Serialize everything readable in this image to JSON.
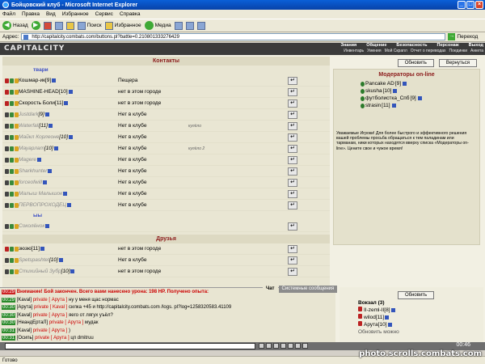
{
  "window": {
    "title": "Бойцовский клуб - Microsoft Internet Explorer"
  },
  "menu": [
    "Файл",
    "Правка",
    "Вид",
    "Избранное",
    "Сервис",
    "Справка"
  ],
  "toolbar": {
    "back": "Назад",
    "search": "Поиск",
    "favorites": "Избранное",
    "media": "Медиа"
  },
  "address": {
    "label": "Адрес:",
    "url": "http://capitalcity.combats.com/buttons.pl?battle=0.210801333276429",
    "go": "Переход"
  },
  "game": {
    "logo": "CAPITALCITY",
    "nav_top": [
      "Знания",
      "Общение",
      "Безопасность",
      "Персонаж",
      "Выход"
    ],
    "nav_bottom": [
      "Инвентарь",
      "Умения",
      "Мой Скрапл",
      "Отчет о переводах",
      "Поединки",
      "Анкета"
    ]
  },
  "contacts": {
    "title": "Контакты",
    "group1": "твари",
    "group2": "ыы",
    "friends_title": "Друзья",
    "rows": [
      {
        "name": "Кошмар-ик",
        "level": "[9]",
        "loc": "Пещера",
        "note": "",
        "online": true
      },
      {
        "name": "MASHINE-HEAD",
        "level": "[10]",
        "loc": "нет в этом городе",
        "note": "",
        "online": true
      },
      {
        "name": "Скорость Боли",
        "level": "[11]",
        "loc": "нет в этом городе",
        "note": "",
        "online": true
      },
      {
        "name": "Justdark",
        "level": "[9]",
        "loc": "Нет в клубе",
        "note": "",
        "online": false
      },
      {
        "name": "Waterfall",
        "level": "[11]",
        "loc": "Нет в клубе",
        "note": "кулёло",
        "online": false
      },
      {
        "name": "Майкл Корлеоне",
        "level": "[10]",
        "loc": "Нет в клубе",
        "note": "",
        "online": false
      },
      {
        "name": "Мауарлат",
        "level": "[10]",
        "loc": "Нет в клубе",
        "note": "кулёло 2",
        "online": false
      },
      {
        "name": "Magere",
        "level": "",
        "loc": "Нет в клубе",
        "note": "",
        "online": false
      },
      {
        "name": "Sharkhunter",
        "level": "",
        "loc": "Нет в клубе",
        "note": "",
        "online": false
      },
      {
        "name": "forceofwill",
        "level": "",
        "loc": "Нет в клубе",
        "note": "",
        "online": false
      },
      {
        "name": "Малыш Малышок",
        "level": "",
        "loc": "Нет в клубе",
        "note": "",
        "online": false
      },
      {
        "name": "ПЕРВОПРОХОДЕЦ",
        "level": "",
        "loc": "Нет в клубе",
        "note": "",
        "online": false
      }
    ],
    "group2_rows": [
      {
        "name": "Соколёнок",
        "level": "",
        "loc": "",
        "note": "",
        "online": false
      }
    ],
    "friends_rows": [
      {
        "name": "зюзю",
        "level": "[11]",
        "loc": "нет в этом городе",
        "online": true
      },
      {
        "name": "Spetspashtet",
        "level": "[10]",
        "loc": "Нет в клубе",
        "online": false
      },
      {
        "name": "Стихийный Зубр",
        "level": "[10]",
        "loc": "нет в этом городе",
        "online": false
      }
    ]
  },
  "right": {
    "refresh": "Обновить",
    "return": "Вернуться",
    "mods_title": "Модераторы on-line",
    "mods": [
      {
        "name": "Pancake AD",
        "level": "[9]"
      },
      {
        "name": "skusha",
        "level": "[10]"
      },
      {
        "name": "футболистка_Спб",
        "level": "[9]"
      },
      {
        "name": "strasin",
        "level": "[11]"
      }
    ],
    "mods_msg": "Уважаемые Игроки! Для более быстрого и эффективного решения вашей проблемы просьба обращаться к тем паладинам или тарманам, ники которых находятся вверху списка «Модераторы on-line». Цените свое и чужое время!"
  },
  "chat": {
    "tab_chat": "Чат",
    "tab_system": "Системные сообщения",
    "lines": [
      {
        "time": "00:29",
        "from": "",
        "to": "",
        "text": "Внимание! Бой закончен. Всего вами нанесено урона: 198 HP. Получено опыта:",
        "sys": true
      },
      {
        "time": "00:29",
        "from": "[Kaval]",
        "to": "private [ Арута ]",
        "text": "ну у меня щас нормас",
        "sys": false
      },
      {
        "time": "00:30",
        "from": "[Арута]",
        "to": "private [ Kaval ]",
        "text": "силка +45 и http://capitalcity.combats.com /logs. pl?log=1258320583.41109",
        "sys": false
      },
      {
        "time": "00:30",
        "from": "[Kaval]",
        "to": "private [ Арута ]",
        "text": "яего от лягух уъёл?",
        "sys": false
      },
      {
        "time": "00:30",
        "from": "[НеандЕртаЛ]",
        "to": "private [ Арута ]",
        "text": "мудак",
        "sys": false
      },
      {
        "time": "00:31",
        "from": "[Kaval]",
        "to": "private [ Арута ]",
        "text": ")",
        "sys": false
      },
      {
        "time": "00:31",
        "from": "[Осипь]",
        "to": "private [ Арута ]",
        "text": "цп dmitruu",
        "sys": false
      },
      {
        "time": "00:31",
        "from": "[Арута]",
        "to": "private [ skusha ]",
        "text": "00:30 [НеандЕртаЛ] private [ Арута ] мудак",
        "sys": false
      }
    ]
  },
  "online_panel": {
    "refresh": "Обновить",
    "location": "Вокзал (3)",
    "users": [
      {
        "name": "II-zeml-II",
        "level": "[8]"
      },
      {
        "name": "wilod",
        "level": "[11]"
      },
      {
        "name": "Арута",
        "level": "[10]"
      }
    ],
    "footer": "Обновить можно"
  },
  "clock": "00:46",
  "status": "Готово",
  "watermark": "photo.scrolls.combats.com"
}
